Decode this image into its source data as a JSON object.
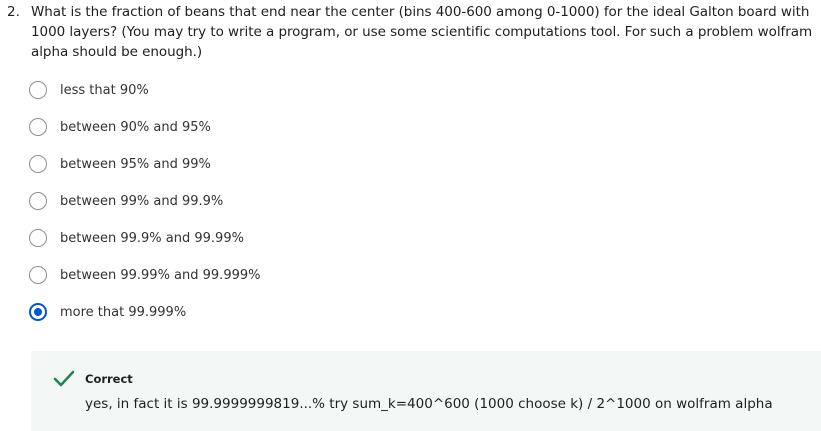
{
  "question": {
    "number": "2.",
    "text": "What is the fraction of beans that end near the center (bins 400-600 among 0-1000) for the ideal Galton board with 1000 layers? (You may try to write a program, or use some scientific computations tool. For such a problem wolfram alpha should be enough.)"
  },
  "options": [
    {
      "label": "less that 90%",
      "selected": false
    },
    {
      "label": "between 90% and 95%",
      "selected": false
    },
    {
      "label": "between 95% and 99%",
      "selected": false
    },
    {
      "label": "between 99% and 99.9%",
      "selected": false
    },
    {
      "label": "between 99.9% and 99.99%",
      "selected": false
    },
    {
      "label": "between 99.99% and 99.999%",
      "selected": false
    },
    {
      "label": "more that 99.999%",
      "selected": true
    }
  ],
  "feedback": {
    "status": "Correct",
    "icon": "checkmark-icon",
    "color": "#1f8354",
    "text": "yes, in fact it is 99.9999999819...% try sum_k=400^600 (1000 choose k) / 2^1000 on wolfram alpha"
  },
  "colors": {
    "selected_radio": "#0056d2",
    "feedback_background": "#f3f8f6"
  }
}
